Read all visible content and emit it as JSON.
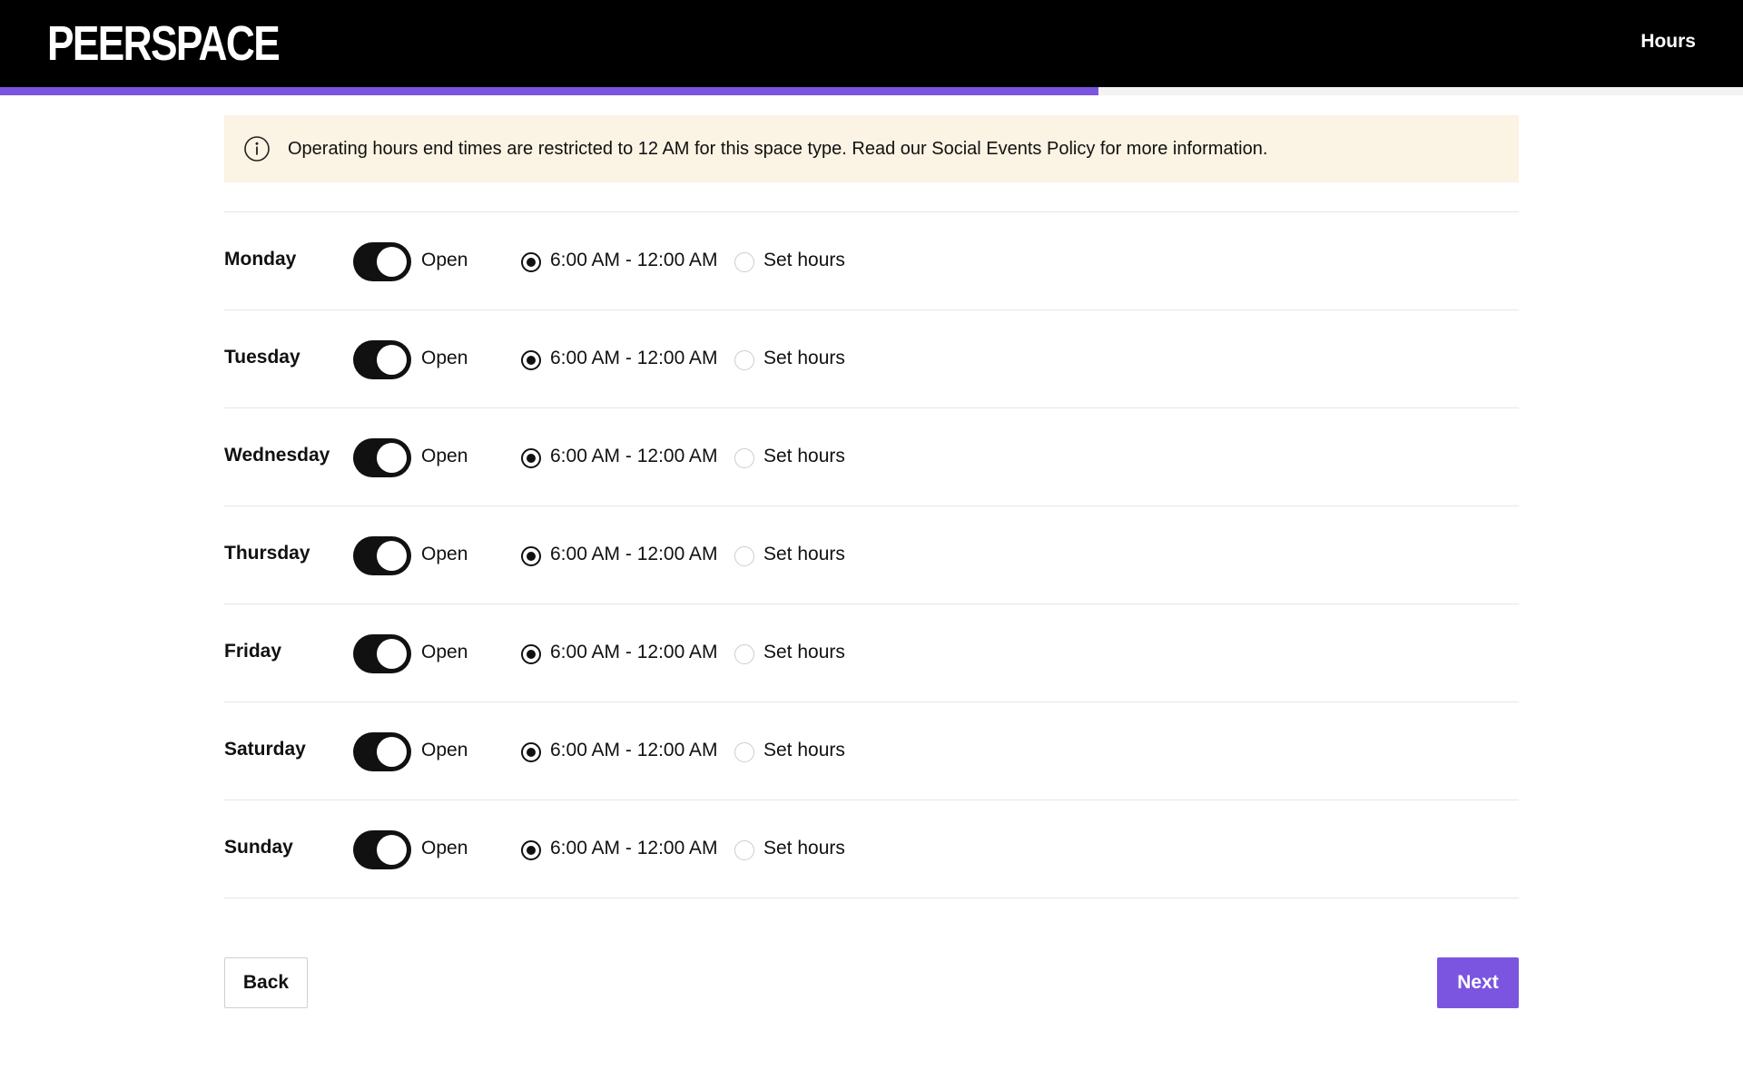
{
  "header": {
    "logo_text": "PEERSPACE",
    "page_title": "Hours"
  },
  "progress": {
    "fraction": 0.63
  },
  "banner": {
    "icon": "info-icon",
    "text": "Operating hours end times are restricted to 12 AM for this space type. Read our Social Events Policy for more information."
  },
  "days": [
    {
      "name": "Monday",
      "open_label": "Open",
      "is_open": true,
      "range_label": "6:00 AM - 12:00 AM",
      "set_label": "Set hours",
      "selected": "range"
    },
    {
      "name": "Tuesday",
      "open_label": "Open",
      "is_open": true,
      "range_label": "6:00 AM - 12:00 AM",
      "set_label": "Set hours",
      "selected": "range"
    },
    {
      "name": "Wednesday",
      "open_label": "Open",
      "is_open": true,
      "range_label": "6:00 AM - 12:00 AM",
      "set_label": "Set hours",
      "selected": "range"
    },
    {
      "name": "Thursday",
      "open_label": "Open",
      "is_open": true,
      "range_label": "6:00 AM - 12:00 AM",
      "set_label": "Set hours",
      "selected": "range"
    },
    {
      "name": "Friday",
      "open_label": "Open",
      "is_open": true,
      "range_label": "6:00 AM - 12:00 AM",
      "set_label": "Set hours",
      "selected": "range"
    },
    {
      "name": "Saturday",
      "open_label": "Open",
      "is_open": true,
      "range_label": "6:00 AM - 12:00 AM",
      "set_label": "Set hours",
      "selected": "range"
    },
    {
      "name": "Sunday",
      "open_label": "Open",
      "is_open": true,
      "range_label": "6:00 AM - 12:00 AM",
      "set_label": "Set hours",
      "selected": "range"
    }
  ],
  "footer": {
    "back_label": "Back",
    "next_label": "Next"
  },
  "colors": {
    "accent": "#7b55e0",
    "banner_bg": "#fbf3e3",
    "toggle_on": "#111111"
  }
}
